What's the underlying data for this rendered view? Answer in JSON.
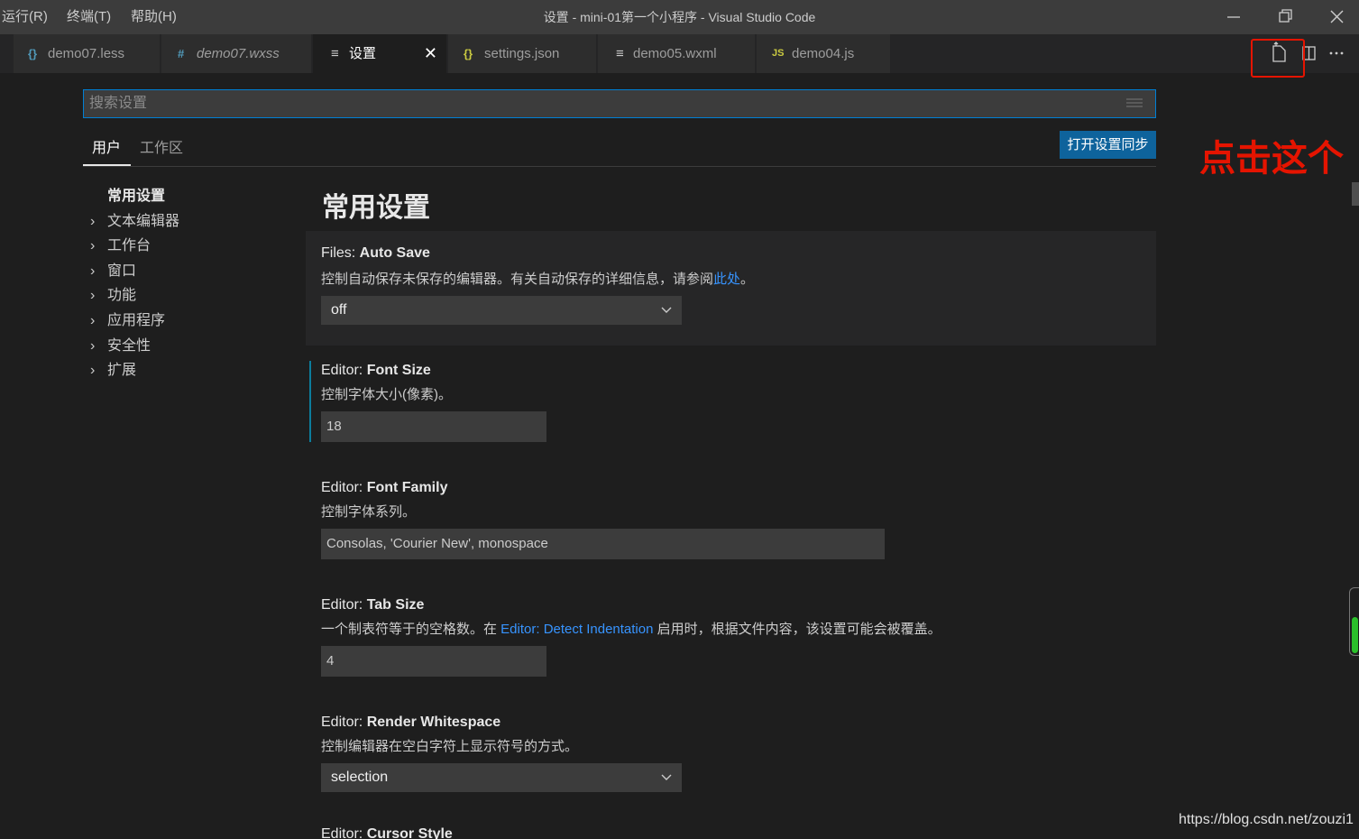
{
  "menu": [
    "运行(R)",
    "终端(T)",
    "帮助(H)"
  ],
  "window_title": "设置 - mini-01第一个小程序 - Visual Studio Code",
  "tabs": [
    {
      "icon": "{}",
      "label": "demo07.less",
      "color": "#519aba"
    },
    {
      "icon": "#",
      "label": "demo07.wxss",
      "color": "#519aba"
    },
    {
      "icon": "≡",
      "label": "设置",
      "color": "#cccccc"
    },
    {
      "icon": "{}",
      "label": "settings.json",
      "color": "#cbcb41"
    },
    {
      "icon": "≡",
      "label": "demo05.wxml",
      "color": "#cccccc"
    },
    {
      "icon": "JS",
      "label": "demo04.js",
      "color": "#cbcb41"
    }
  ],
  "search": {
    "placeholder": "搜索设置"
  },
  "scope_tabs": [
    "用户",
    "工作区"
  ],
  "sync_button": "打开设置同步",
  "annotation": "点击这个",
  "toc": {
    "head": "常用设置",
    "items": [
      "文本编辑器",
      "工作台",
      "窗口",
      "功能",
      "应用程序",
      "安全性",
      "扩展"
    ]
  },
  "section_title": "常用设置",
  "settings": [
    {
      "category": "Files: ",
      "name": "Auto Save",
      "desc_before": "控制自动保存未保存的编辑器。有关自动保存的详细信息，请参阅",
      "desc_link": "此处",
      "desc_after": "。",
      "value": "off"
    },
    {
      "category": "Editor: ",
      "name": "Font Size",
      "desc": "控制字体大小(像素)。",
      "value": "18"
    },
    {
      "category": "Editor: ",
      "name": "Font Family",
      "desc": "控制字体系列。",
      "value": "Consolas, 'Courier New', monospace"
    },
    {
      "category": "Editor: ",
      "name": "Tab Size",
      "desc_before": "一个制表符等于的空格数。在 ",
      "desc_link": "Editor: Detect Indentation",
      "desc_after": " 启用时，根据文件内容，该设置可能会被覆盖。",
      "value": "4"
    },
    {
      "category": "Editor: ",
      "name": "Render Whitespace",
      "desc": "控制编辑器在空白字符上显示符号的方式。",
      "value": "selection"
    },
    {
      "category": "Editor: ",
      "name": "Cursor Style"
    }
  ],
  "watermark": "https://blog.csdn.net/zouzi1"
}
